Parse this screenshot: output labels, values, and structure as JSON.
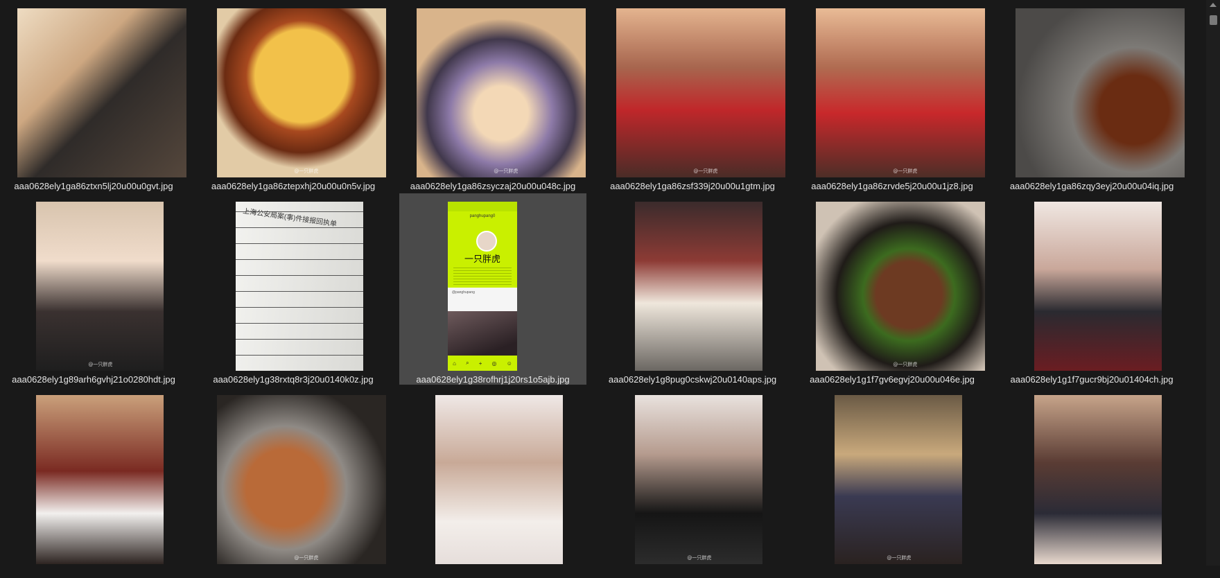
{
  "files": [
    {
      "name": "aaa0628ely1ga86ztxn5lj20u00u0gvt.jpg",
      "bg": "linear-gradient(135deg,#eedcc2 0%,#cda781 35%,#2f2b29 55%,#55473c 100%)",
      "wm": ""
    },
    {
      "name": "aaa0628ely1ga86ztepxhj20u00u0n5v.jpg",
      "bg": "radial-gradient(circle at 50% 40%,#f2c14a 0 35%,#a8491f 42%,#6b2b12 58%,#e2cba6 70%)",
      "wm": "@一只胖虎"
    },
    {
      "name": "aaa0628ely1ga86zsyczaj20u00u048c.jpg",
      "bg": "radial-gradient(circle at 50% 62%,#f3d8b6 0 20%,#8d7aa8 38%,#41384c 55%,#d9b48b 70%)",
      "wm": "@一只胖虎"
    },
    {
      "name": "aaa0628ely1ga86zsf339j20u00u1gtm.jpg",
      "bg": "linear-gradient(180deg,#e4b48f 0%,#a7654e 35%,#c0272a 60%,#4a2c27 100%)",
      "wm": "@一只胖虎"
    },
    {
      "name": "aaa0628ely1ga86zrvde5j20u00u1jz8.jpg",
      "bg": "linear-gradient(180deg,#e9bb96 0%,#b06b51 35%,#c8282b 62%,#4d2e27 100%)",
      "wm": "@一只胖虎"
    },
    {
      "name": "aaa0628ely1ga86zqy3eyj20u00u04iq.jpg",
      "bg": "radial-gradient(circle at 70% 60%,#6a2c12 0 22%,#7d7a76 40%,#4c4a48 75%)",
      "wm": ""
    },
    {
      "name": "aaa0628ely1g89arh6gvhj21o0280hdt.jpg",
      "bg": "linear-gradient(180deg,#d8c4ae 0%,#f0dccb 35%,#3a3130 65%,#1e1e1e 100%)",
      "wm": "@一只胖虎",
      "portrait": true
    },
    {
      "name": "aaa0628ely1g38rxtq8r3j20u0140k0z.jpg",
      "doc": true,
      "wm": "",
      "portrait": true
    },
    {
      "name": "aaa0628ely1g38rofhrj1j20rs1o5ajb.jpg",
      "phone": true,
      "wm": "",
      "portrait": true,
      "selected": true
    },
    {
      "name": "aaa0628ely1g8pug0cskwj20u0140aps.jpg",
      "bg": "linear-gradient(180deg,#3b2b2c 0%,#8d3b35 35%,#efe7dc 60%,#6b6762 100%)",
      "wm": "",
      "portrait": true
    },
    {
      "name": "aaa0628ely1g1f7gv6egvj20u00u046e.jpg",
      "bg": "radial-gradient(circle at 55% 55%,#6d3a22 0 25%,#3c6b1f 35%,#1f1b18 55%,#cfc2b4 80%)",
      "wm": "@一只胖虎"
    },
    {
      "name": "aaa0628ely1g1f7gucr9bj20u01404ch.jpg",
      "bg": "linear-gradient(180deg,#f0e7e2 0%,#c9a79a 40%,#2a2a30 65%,#6b1d22 100%)",
      "wm": "",
      "portrait": true
    },
    {
      "name": "",
      "bg": "linear-gradient(180deg,#caa07b 0%,#7a2a22 45%,#f2f0ee 70%,#2d2421 100%)",
      "wm": "",
      "portrait": true
    },
    {
      "name": "",
      "bg": "radial-gradient(circle at 40% 55%,#b96a38 0 28%,#8f8a85 45%,#2a2623 75%)",
      "wm": "@一只胖虎"
    },
    {
      "name": "",
      "bg": "linear-gradient(180deg,#efe8e6 0%,#c8a997 40%,#f3eeea 75%,#e6dedb 100%)",
      "wm": "",
      "portrait": true
    },
    {
      "name": "",
      "bg": "linear-gradient(180deg,#e9e2de 0%,#b59b8e 35%,#151515 70%,#2c2c2c 100%)",
      "wm": "@一只胖虎",
      "portrait": true
    },
    {
      "name": "",
      "bg": "linear-gradient(180deg,#6a5a45 0%,#c9a97c 35%,#3a3a52 60%,#2a2220 100%)",
      "wm": "@一只胖虎",
      "portrait": true
    },
    {
      "name": "",
      "bg": "linear-gradient(180deg,#c7a48a 0%,#5a3c34 40%,#2b2b36 70%,#e9d9ce 100%)",
      "wm": "",
      "portrait": true
    }
  ],
  "doc": {
    "title": "上海公安局案(事)件接报回执单"
  },
  "phone": {
    "handle": "panghupang0",
    "name": "一只胖虎",
    "account_label": "@panghupang",
    "nav": [
      "⌂",
      "⌕",
      "+",
      "◎",
      "☺"
    ]
  }
}
